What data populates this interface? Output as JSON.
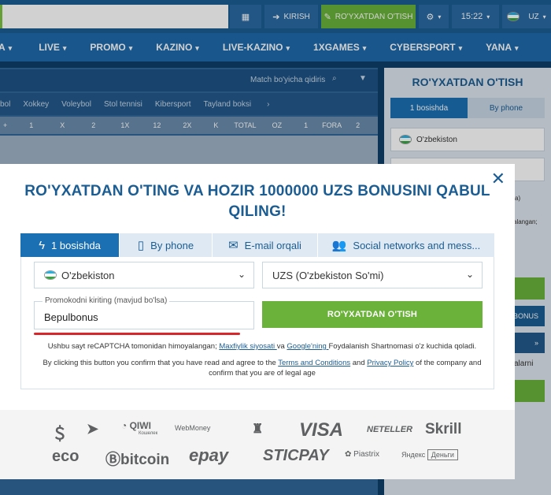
{
  "topbar": {
    "login_label": "KIRISH",
    "register_label": "RO'YXATDAN O'TISH",
    "time": "15:22",
    "lang": "UZ",
    "colors": {
      "bar": "#1b5d93",
      "green": "#6ab23a"
    }
  },
  "nav": {
    "items": [
      "A",
      "LIVE",
      "PROMO",
      "KAZINO",
      "LIVE-KAZINO",
      "1XGAMES",
      "CYBERSPORT",
      "YANA"
    ]
  },
  "background": {
    "search_placeholder": "Match bo'yicha qidiris",
    "sports": [
      "bol",
      "Xokkey",
      "Voleybol",
      "Stol tennisi",
      "Kibersport",
      "Tayland boksi"
    ],
    "columns": [
      "+",
      "1",
      "X",
      "2",
      "1X",
      "12",
      "2X",
      "K",
      "TOTAL",
      "OZ",
      "1",
      "FORA",
      "2"
    ],
    "side": {
      "title": "RO'YXATDAN O'TISH",
      "tab1": "1 bosishda",
      "tab2": "By phone",
      "country": "O'zbekiston",
      "bonus": "BONUS",
      "snippet_a": "a)",
      "snippet_b": "alangan;",
      "snippet_c": "salarni"
    }
  },
  "modal": {
    "title": "RO'YXATDAN O'TING VA HOZIR 1000000 UZS BONUSINI QABUL QILING!",
    "tabs": [
      {
        "label": "1 bosishda",
        "icon": "lightning-icon"
      },
      {
        "label": "By phone",
        "icon": "phone-icon"
      },
      {
        "label": "E-mail orqali",
        "icon": "envelope-icon"
      },
      {
        "label": "Social networks and mess...",
        "icon": "users-icon"
      }
    ],
    "country": "O'zbekiston",
    "currency": "UZS (O'zbekiston So'mi)",
    "promo_label": "Promokodni kiriting (mavjud bo'lsa)",
    "promo_value": "Bepulbonus",
    "register_button": "RO'YXATDAN O'TISH",
    "recaptcha_prefix": "Ushbu sayt reCAPTCHA tomonidan himoyalangan; ",
    "privacy_link": "Maxfiylik siyosati ",
    "recaptcha_mid": "va ",
    "google_link": "Google'ning ",
    "recaptcha_suffix": "Foydalanish Shartnomasi o'z kuchida qoladi.",
    "terms_prefix": "By clicking this button you confirm that you have read and agree to the ",
    "terms_link": "Terms and Conditions",
    "terms_mid": " and ",
    "policy_link": "Privacy Policy",
    "terms_suffix": " of the company and confirm that you are of legal age"
  },
  "payments": {
    "row1": [
      "QIWI",
      "WebMoney",
      "VISA",
      "NETELLER",
      "Skrill"
    ],
    "qiwi_sub": "Кошелек",
    "row2": [
      "eco",
      "bitcoin",
      "epay",
      "STICPAY",
      "Piastrix",
      "Яндекс",
      "Деньги"
    ]
  }
}
